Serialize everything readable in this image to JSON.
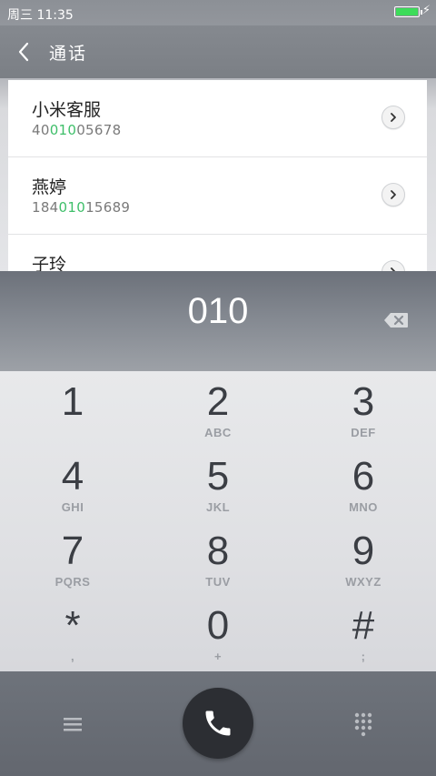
{
  "status_bar": {
    "day": "周三",
    "time": "11:35"
  },
  "header": {
    "title": "通话"
  },
  "contacts": [
    {
      "name": "小米客服",
      "number_prefix": "40",
      "number_match": "010",
      "number_suffix": "05678"
    },
    {
      "name": "燕婷",
      "number_prefix": "184",
      "number_match": "010",
      "number_suffix": "15689"
    },
    {
      "name": "子玲",
      "number_prefix": "",
      "number_match": "",
      "number_suffix": ""
    }
  ],
  "dialer": {
    "entered_number": "010",
    "keys": [
      {
        "digit": "1",
        "letters": ""
      },
      {
        "digit": "2",
        "letters": "ABC"
      },
      {
        "digit": "3",
        "letters": "DEF"
      },
      {
        "digit": "4",
        "letters": "GHI"
      },
      {
        "digit": "5",
        "letters": "JKL"
      },
      {
        "digit": "6",
        "letters": "MNO"
      },
      {
        "digit": "7",
        "letters": "PQRS"
      },
      {
        "digit": "8",
        "letters": "TUV"
      },
      {
        "digit": "9",
        "letters": "WXYZ"
      },
      {
        "digit": "*",
        "letters": ","
      },
      {
        "digit": "0",
        "letters": "+"
      },
      {
        "digit": "#",
        "letters": ";"
      }
    ]
  },
  "colors": {
    "match_highlight": "#3fbf6a",
    "battery": "#3ddc5a",
    "call_button": "#2c2e33"
  },
  "icons": {
    "back": "chevron-left-icon",
    "contact_detail": "chevron-right-icon",
    "backspace": "backspace-icon",
    "menu": "menu-icon",
    "call": "phone-icon",
    "dialpad": "dialpad-icon"
  }
}
